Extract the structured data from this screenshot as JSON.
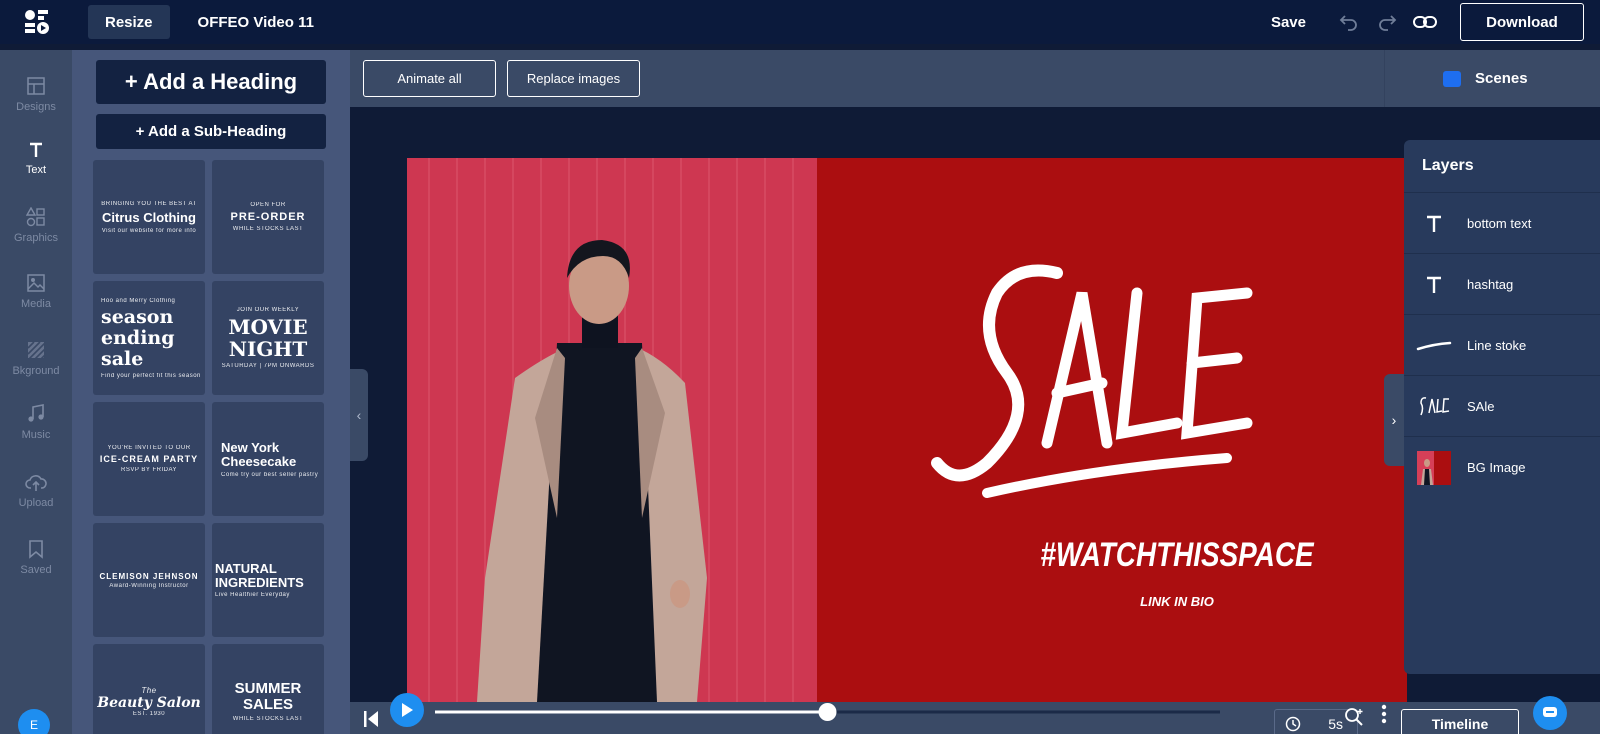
{
  "topbar": {
    "resize_label": "Resize",
    "title": "OFFEO Video 11",
    "save_label": "Save",
    "download_label": "Download"
  },
  "rail": {
    "items": [
      {
        "label": "Designs",
        "icon": "layout-icon"
      },
      {
        "label": "Text",
        "icon": "text-icon"
      },
      {
        "label": "Graphics",
        "icon": "shapes-icon"
      },
      {
        "label": "Media",
        "icon": "image-icon"
      },
      {
        "label": "Bkground",
        "icon": "pattern-icon"
      },
      {
        "label": "Music",
        "icon": "music-icon"
      },
      {
        "label": "Upload",
        "icon": "cloud-upload-icon"
      },
      {
        "label": "Saved",
        "icon": "bookmark-icon"
      }
    ],
    "avatar_initial": "E"
  },
  "text_panel": {
    "add_heading": "+ Add a Heading",
    "add_subheading": "+ Add a Sub-Heading",
    "templates": [
      {
        "small": "BRINGING YOU THE BEST AT",
        "big": "Citrus Clothing",
        "sub": "Visit our website for more info"
      },
      {
        "small": "OPEN FOR",
        "big": "PRE-ORDER",
        "sub": "WHILE STOCKS LAST"
      },
      {
        "small": "Hoo and Merry Clothing",
        "big": "season ending sale",
        "sub": "Find your perfect fit this season"
      },
      {
        "small": "JOIN OUR WEEKLY",
        "big": "MOVIE NIGHT",
        "sub": "SATURDAY | 7PM ONWARDS"
      },
      {
        "small": "YOU'RE INVITED TO OUR",
        "big": "ICE-CREAM PARTY",
        "sub": "RSVP BY FRIDAY"
      },
      {
        "small": "",
        "big": "New York Cheesecake",
        "sub": "Come try our best seller pastry"
      },
      {
        "small": "",
        "big": "CLEMISON JEHNSON",
        "sub": "Award-Winning Instructor"
      },
      {
        "small": "",
        "big": "NATURAL INGREDIENTS",
        "sub": "Live Healthier Everyday"
      },
      {
        "small": "The",
        "big": "Beauty Salon",
        "sub": "EST. 1930"
      },
      {
        "small": "",
        "big": "SUMMER SALES",
        "sub": "WHILE STOCKS LAST"
      }
    ]
  },
  "toolbar": {
    "animate_all": "Animate all",
    "replace_images": "Replace images",
    "scenes": "Scenes"
  },
  "canvas": {
    "sale_text": "SAle",
    "hashtag": "#WATCHTHISSPACE",
    "bottom_text": "LINK IN BIO",
    "bg_color": "#ab0e10"
  },
  "layers": {
    "title": "Layers",
    "items": [
      {
        "label": "bottom text",
        "icon": "text-icon"
      },
      {
        "label": "hashtag",
        "icon": "text-icon"
      },
      {
        "label": "Line stoke",
        "icon": "stroke-icon"
      },
      {
        "label": "SAle",
        "icon": "sale-thumb-icon"
      },
      {
        "label": "BG Image",
        "icon": "image-thumb-icon"
      }
    ]
  },
  "playback": {
    "duration": "5s",
    "timeline_label": "Timeline",
    "progress": 0.5
  }
}
